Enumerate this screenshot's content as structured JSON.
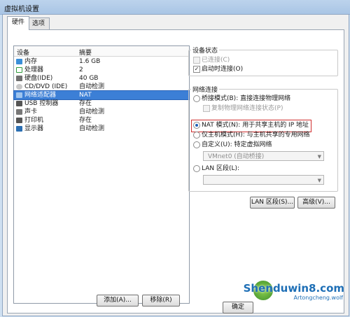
{
  "window": {
    "title": "虚拟机设置"
  },
  "tabs": [
    {
      "label": "硬件",
      "active": true
    },
    {
      "label": "选项",
      "active": false
    }
  ],
  "device_table": {
    "headers": [
      "设备",
      "摘要"
    ],
    "rows": [
      {
        "name": "内存",
        "value": "1.6 GB",
        "icon": "memory-icon",
        "color": "#3a8fd8"
      },
      {
        "name": "处理器",
        "value": "2",
        "icon": "processor-icon",
        "color": "#2e9a3a"
      },
      {
        "name": "硬盘(IDE)",
        "value": "40 GB",
        "icon": "harddisk-icon",
        "color": "#707070"
      },
      {
        "name": "CD/DVD (IDE)",
        "value": "自动检测",
        "icon": "cd-icon",
        "color": "#9a9a9a"
      },
      {
        "name": "网络适配器",
        "value": "NAT",
        "icon": "network-icon",
        "color": "#3f6fb0",
        "selected": true
      },
      {
        "name": "USB 控制器",
        "value": "存在",
        "icon": "usb-icon",
        "color": "#555555"
      },
      {
        "name": "声卡",
        "value": "自动检测",
        "icon": "sound-icon",
        "color": "#777777"
      },
      {
        "name": "打印机",
        "value": "存在",
        "icon": "printer-icon",
        "color": "#555555"
      },
      {
        "name": "显示器",
        "value": "自动检测",
        "icon": "display-icon",
        "color": "#2b6fb3"
      }
    ]
  },
  "buttons": {
    "add": "添加(A)...",
    "remove": "移除(R)",
    "lan_segments": "LAN 区段(S)...",
    "advanced": "高级(V)...",
    "ok": "确定"
  },
  "device_status": {
    "title": "设备状态",
    "connected": {
      "label": "已连接(C)",
      "checked": false,
      "enabled": false
    },
    "connect_on_power": {
      "label": "启动时连接(O)",
      "checked": true,
      "enabled": true
    }
  },
  "network_connection": {
    "title": "网络连接",
    "bridged": {
      "label": "桥接模式(B): 直接连接物理网络"
    },
    "replicate": {
      "label": "复制物理网络连接状态(P)"
    },
    "nat": {
      "label": "NAT 模式(N): 用于共享主机的 IP 地址"
    },
    "host_only": {
      "label": "仅主机模式(H): 与主机共享的专用网络"
    },
    "custom": {
      "label": "自定义(U): 特定虚拟网络"
    },
    "custom_select": "VMnet0 (自动桥接)",
    "lan_segment": {
      "label": "LAN 区段(L):"
    },
    "lan_select": ""
  },
  "watermark": {
    "text": "Shenduwin8.com",
    "sub": "Artongcheng.wolf"
  }
}
